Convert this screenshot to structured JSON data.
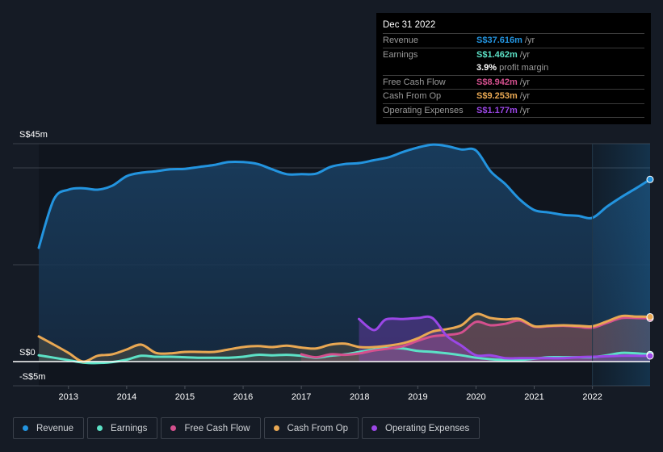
{
  "tooltip": {
    "date": "Dec 31 2022",
    "rows": [
      {
        "label": "Revenue",
        "value": "S$37.616m",
        "unit": "/yr",
        "color": "#2394df"
      },
      {
        "label": "Earnings",
        "value": "S$1.462m",
        "unit": "/yr",
        "color": "#5ce1c6"
      },
      {
        "label": "",
        "value": "3.9%",
        "unit": "profit margin",
        "color": "#ffffff"
      },
      {
        "label": "Free Cash Flow",
        "value": "S$8.942m",
        "unit": "/yr",
        "color": "#d4508e"
      },
      {
        "label": "Cash From Op",
        "value": "S$9.253m",
        "unit": "/yr",
        "color": "#e9a853"
      },
      {
        "label": "Operating Expenses",
        "value": "S$1.177m",
        "unit": "/yr",
        "color": "#9b47e6"
      }
    ]
  },
  "legend": [
    {
      "label": "Revenue",
      "color": "#2394df"
    },
    {
      "label": "Earnings",
      "color": "#5ce1c6"
    },
    {
      "label": "Free Cash Flow",
      "color": "#d4508e"
    },
    {
      "label": "Cash From Op",
      "color": "#e9a853"
    },
    {
      "label": "Operating Expenses",
      "color": "#9b47e6"
    }
  ],
  "chart_data": {
    "type": "area",
    "title": "",
    "xlabel": "",
    "ylabel": "",
    "unit": "S$ millions",
    "ylim": [
      -5,
      45
    ],
    "xlim": [
      2012.49,
      2022.99
    ],
    "y_tick_labels": [
      {
        "value": 45,
        "label": "S$45m"
      },
      {
        "value": 0,
        "label": "S$0"
      },
      {
        "value": -5,
        "label": "-S$5m"
      }
    ],
    "gridlines": [
      45,
      40,
      20
    ],
    "x_ticks": [
      2013,
      2014,
      2015,
      2016,
      2017,
      2018,
      2019,
      2020,
      2021,
      2022
    ],
    "x_tick_labels": [
      "2013",
      "2014",
      "2015",
      "2016",
      "2017",
      "2018",
      "2019",
      "2020",
      "2021",
      "2022"
    ],
    "highlight_range": [
      2022.0,
      2022.99
    ],
    "series": [
      {
        "name": "Revenue",
        "color": "#2394df",
        "points": [
          [
            2012.49,
            23.5
          ],
          [
            2012.75,
            33.5
          ],
          [
            2013.0,
            35.5
          ],
          [
            2013.25,
            35.8
          ],
          [
            2013.5,
            35.5
          ],
          [
            2013.75,
            36.3
          ],
          [
            2014.0,
            38.3
          ],
          [
            2014.25,
            39.0
          ],
          [
            2014.5,
            39.3
          ],
          [
            2014.75,
            39.7
          ],
          [
            2015.0,
            39.8
          ],
          [
            2015.25,
            40.2
          ],
          [
            2015.5,
            40.6
          ],
          [
            2015.75,
            41.2
          ],
          [
            2016.0,
            41.2
          ],
          [
            2016.25,
            40.8
          ],
          [
            2016.5,
            39.7
          ],
          [
            2016.75,
            38.7
          ],
          [
            2017.0,
            38.7
          ],
          [
            2017.25,
            38.8
          ],
          [
            2017.5,
            40.2
          ],
          [
            2017.75,
            40.8
          ],
          [
            2018.0,
            41.0
          ],
          [
            2018.25,
            41.6
          ],
          [
            2018.5,
            42.2
          ],
          [
            2018.75,
            43.3
          ],
          [
            2019.0,
            44.2
          ],
          [
            2019.25,
            44.8
          ],
          [
            2019.5,
            44.5
          ],
          [
            2019.75,
            43.8
          ],
          [
            2020.0,
            43.6
          ],
          [
            2020.25,
            39.3
          ],
          [
            2020.5,
            36.7
          ],
          [
            2020.75,
            33.5
          ],
          [
            2021.0,
            31.3
          ],
          [
            2021.25,
            30.8
          ],
          [
            2021.5,
            30.3
          ],
          [
            2021.75,
            30.1
          ],
          [
            2022.0,
            29.7
          ],
          [
            2022.25,
            32.0
          ],
          [
            2022.5,
            34.0
          ],
          [
            2022.75,
            35.8
          ],
          [
            2022.99,
            37.616
          ]
        ]
      },
      {
        "name": "Earnings",
        "color": "#5ce1c6",
        "points": [
          [
            2012.49,
            1.3
          ],
          [
            2012.75,
            0.8
          ],
          [
            2013.0,
            0.3
          ],
          [
            2013.25,
            -0.2
          ],
          [
            2013.5,
            -0.3
          ],
          [
            2013.75,
            -0.1
          ],
          [
            2014.0,
            0.4
          ],
          [
            2014.25,
            1.2
          ],
          [
            2014.5,
            1.0
          ],
          [
            2014.75,
            1.0
          ],
          [
            2015.0,
            0.9
          ],
          [
            2015.25,
            0.8
          ],
          [
            2015.5,
            0.8
          ],
          [
            2015.75,
            0.8
          ],
          [
            2016.0,
            1.0
          ],
          [
            2016.25,
            1.4
          ],
          [
            2016.5,
            1.3
          ],
          [
            2016.75,
            1.4
          ],
          [
            2017.0,
            1.2
          ],
          [
            2017.25,
            0.8
          ],
          [
            2017.5,
            1.2
          ],
          [
            2017.75,
            1.5
          ],
          [
            2018.0,
            2.0
          ],
          [
            2018.25,
            2.5
          ],
          [
            2018.5,
            2.8
          ],
          [
            2018.75,
            2.7
          ],
          [
            2019.0,
            2.2
          ],
          [
            2019.25,
            2.0
          ],
          [
            2019.5,
            1.7
          ],
          [
            2019.75,
            1.3
          ],
          [
            2020.0,
            0.8
          ],
          [
            2020.25,
            0.5
          ],
          [
            2020.5,
            0.3
          ],
          [
            2020.75,
            0.3
          ],
          [
            2021.0,
            0.6
          ],
          [
            2021.25,
            0.9
          ],
          [
            2021.5,
            0.9
          ],
          [
            2021.75,
            0.9
          ],
          [
            2022.0,
            0.9
          ],
          [
            2022.25,
            1.3
          ],
          [
            2022.5,
            1.8
          ],
          [
            2022.75,
            1.7
          ],
          [
            2022.99,
            1.462
          ]
        ]
      },
      {
        "name": "Free Cash Flow",
        "color": "#d4508e",
        "points": [
          [
            2017.0,
            1.5
          ],
          [
            2017.25,
            0.9
          ],
          [
            2017.5,
            1.5
          ],
          [
            2017.75,
            1.4
          ],
          [
            2018.0,
            1.7
          ],
          [
            2018.25,
            2.3
          ],
          [
            2018.5,
            2.7
          ],
          [
            2018.75,
            3.2
          ],
          [
            2019.0,
            4.3
          ],
          [
            2019.25,
            5.2
          ],
          [
            2019.5,
            5.5
          ],
          [
            2019.75,
            6.0
          ],
          [
            2020.0,
            8.2
          ],
          [
            2020.25,
            7.5
          ],
          [
            2020.5,
            7.8
          ],
          [
            2020.75,
            8.5
          ],
          [
            2021.0,
            7.2
          ],
          [
            2021.25,
            7.3
          ],
          [
            2021.5,
            7.4
          ],
          [
            2021.75,
            7.2
          ],
          [
            2022.0,
            7.0
          ],
          [
            2022.25,
            8.0
          ],
          [
            2022.5,
            9.0
          ],
          [
            2022.75,
            9.0
          ],
          [
            2022.99,
            8.942
          ]
        ]
      },
      {
        "name": "Cash From Op",
        "color": "#e9a853",
        "points": [
          [
            2012.49,
            5.2
          ],
          [
            2012.75,
            3.5
          ],
          [
            2013.0,
            1.8
          ],
          [
            2013.25,
            0.0
          ],
          [
            2013.5,
            1.2
          ],
          [
            2013.75,
            1.5
          ],
          [
            2014.0,
            2.5
          ],
          [
            2014.25,
            3.5
          ],
          [
            2014.5,
            1.8
          ],
          [
            2014.75,
            1.7
          ],
          [
            2015.0,
            2.0
          ],
          [
            2015.25,
            2.0
          ],
          [
            2015.5,
            2.0
          ],
          [
            2015.75,
            2.5
          ],
          [
            2016.0,
            3.0
          ],
          [
            2016.25,
            3.2
          ],
          [
            2016.5,
            3.0
          ],
          [
            2016.75,
            3.3
          ],
          [
            2017.0,
            2.9
          ],
          [
            2017.25,
            2.7
          ],
          [
            2017.5,
            3.5
          ],
          [
            2017.75,
            3.7
          ],
          [
            2018.0,
            3.0
          ],
          [
            2018.25,
            3.0
          ],
          [
            2018.5,
            3.3
          ],
          [
            2018.75,
            3.8
          ],
          [
            2019.0,
            4.8
          ],
          [
            2019.25,
            6.2
          ],
          [
            2019.5,
            6.7
          ],
          [
            2019.75,
            7.5
          ],
          [
            2020.0,
            9.8
          ],
          [
            2020.25,
            9.0
          ],
          [
            2020.5,
            8.7
          ],
          [
            2020.75,
            8.8
          ],
          [
            2021.0,
            7.3
          ],
          [
            2021.25,
            7.4
          ],
          [
            2021.5,
            7.5
          ],
          [
            2021.75,
            7.4
          ],
          [
            2022.0,
            7.3
          ],
          [
            2022.25,
            8.3
          ],
          [
            2022.5,
            9.4
          ],
          [
            2022.75,
            9.3
          ],
          [
            2022.99,
            9.253
          ]
        ]
      },
      {
        "name": "Operating Expenses",
        "color": "#9b47e6",
        "points": [
          [
            2017.99,
            8.8
          ],
          [
            2018.25,
            6.5
          ],
          [
            2018.45,
            8.7
          ],
          [
            2018.75,
            8.8
          ],
          [
            2019.0,
            9.0
          ],
          [
            2019.25,
            9.0
          ],
          [
            2019.5,
            5.3
          ],
          [
            2019.75,
            3.3
          ],
          [
            2020.0,
            1.3
          ],
          [
            2020.25,
            1.3
          ],
          [
            2020.5,
            0.7
          ],
          [
            2020.75,
            0.7
          ],
          [
            2021.0,
            0.7
          ],
          [
            2021.25,
            0.7
          ],
          [
            2021.5,
            0.7
          ],
          [
            2021.75,
            0.9
          ],
          [
            2022.0,
            1.0
          ],
          [
            2022.25,
            1.1
          ],
          [
            2022.5,
            1.2
          ],
          [
            2022.75,
            1.2
          ],
          [
            2022.99,
            1.177
          ]
        ]
      }
    ]
  }
}
